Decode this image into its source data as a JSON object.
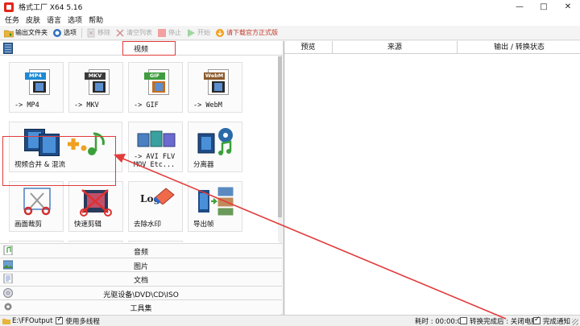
{
  "window": {
    "title": "格式工厂 X64 5.16",
    "controls": [
      "—",
      "□",
      "✕"
    ]
  },
  "menu": [
    "任务",
    "皮肤",
    "语言",
    "选项",
    "帮助"
  ],
  "toolbar": {
    "output_folder": "输出文件夹",
    "options": "选项",
    "remove": "移除",
    "clear_list": "清空列表",
    "stop": "停止",
    "start": "开始",
    "download_official": "请下载官方正式版"
  },
  "category": {
    "active": "视频"
  },
  "tiles": [
    {
      "format": "MP4",
      "label": "-> MP4",
      "color": "#1e88d2"
    },
    {
      "format": "MKV",
      "label": "-> MKV",
      "color": "#3a3a3a"
    },
    {
      "format": "GIF",
      "label": "-> GIF",
      "color": "#3f9c3f"
    },
    {
      "format": "WebM",
      "label": "-> WebM",
      "color": "#8a5a2b"
    },
    {
      "label": "视频合并 & 混流"
    },
    {
      "label": "-> AVI FLV\nMOV Etc..."
    },
    {
      "label": "分离器"
    },
    {
      "label": "画面裁剪"
    },
    {
      "label": "快速剪辑"
    },
    {
      "label": "去除水印",
      "logo_text": "Logo"
    },
    {
      "label": "导出帧"
    }
  ],
  "bottom_categories": [
    "音频",
    "图片",
    "文档",
    "光驱设备\\DVD\\CD\\ISO",
    "工具集"
  ],
  "table_headers": [
    "预览",
    "来源",
    "输出 / 转换状态"
  ],
  "status": {
    "output_path": "E:\\FFOutput",
    "multithread": "使用多线程",
    "elapsed": "耗时 : 00:00:00",
    "after_convert": "转换完成后 : 关闭电脑",
    "notify": "完成通知"
  },
  "colors": {
    "highlight": "#e23b3b",
    "toolbar_download": "#c0392b"
  }
}
